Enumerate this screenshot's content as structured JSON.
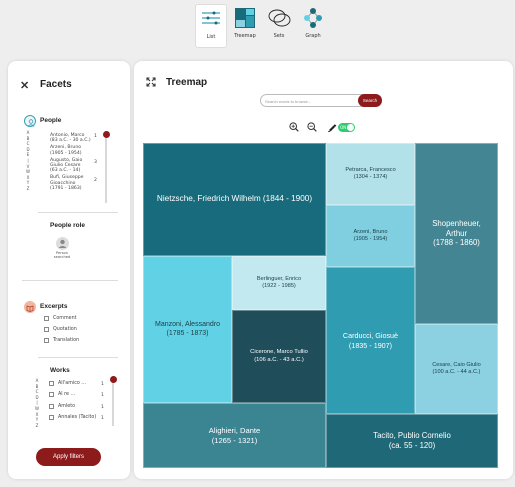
{
  "views": [
    {
      "label": "List",
      "icon": "list-icon",
      "active": true
    },
    {
      "label": "Treemap",
      "icon": "treemap-icon",
      "active": false
    },
    {
      "label": "Sets",
      "icon": "sets-icon",
      "active": false
    },
    {
      "label": "Graph",
      "icon": "graph-icon",
      "active": false
    }
  ],
  "facets": {
    "title": "Facets",
    "people": {
      "title": "People",
      "alphabet_top": [
        "A",
        "B",
        "C",
        "D",
        "E"
      ],
      "alphabet_bottom": [
        "V",
        "W",
        "X",
        "Y",
        "Z"
      ],
      "items": [
        {
          "name": "Antonio, Marco (83 a.C. - 30 a.C.)",
          "line1": "Antonio, Marco",
          "line2": "(83 a.C. - 30 a.C.)",
          "count": "1"
        },
        {
          "name": "Arzeni, Bruno (1905 - 1954)",
          "line1": "Arzeni, Bruno",
          "line2": "(1905 - 1954)",
          "count": ""
        },
        {
          "name": "Augusto, Gaio Giulio Cesare Ottaviano (63 a.C. - 14)",
          "line1": "Augusto, Gaio",
          "line2": "Giulio Cesare",
          "line3": "(63 a.C. - 14)",
          "count": "3"
        },
        {
          "name": "Bufi, Giuseppe Gioacchino (1791 - 1863)",
          "line1": "Bufi, Giuseppe",
          "line2": "Gioacchino",
          "line3": "(1791 - 1863)",
          "count": "2"
        }
      ]
    },
    "people_role": {
      "title": "People role",
      "role_label": "Person searched"
    },
    "excerpts": {
      "title": "Excerpts",
      "options": [
        "Comment",
        "Quotation",
        "Translation"
      ]
    },
    "works": {
      "title": "Works",
      "alphabet_top": [
        "A",
        "B",
        "C",
        "D"
      ],
      "alphabet_bottom": [
        "W",
        "X",
        "Y",
        "Z"
      ],
      "items": [
        {
          "name": "All'amico …",
          "count": "1"
        },
        {
          "name": "Al re …",
          "count": "1"
        },
        {
          "name": "Amleto",
          "count": "1"
        },
        {
          "name": "Annales (Tacito)",
          "count": "1"
        }
      ]
    },
    "apply_label": "Apply filters"
  },
  "main": {
    "title": "Treemap",
    "search": {
      "placeholder": "Search words to browse...",
      "button": "Search"
    },
    "toggle_label": "ON",
    "colors": {
      "accent": "#8e1b1b",
      "toggle": "#2ecc71"
    },
    "tiles": [
      {
        "label": "Nietzsche, Friedrich Wilhelm (1844 - 1900)",
        "line1": "Nietzsche, Friedrich  Wilhelm (1844 - 1900)",
        "line2": "",
        "color": "#186b7c"
      },
      {
        "label": "Manzoni, Alessandro (1785 - 1873)",
        "line1": "Manzoni, Alessandro",
        "line2": "(1785 - 1873)",
        "color": "#61d2e6"
      },
      {
        "label": "Berlinguer, Enrico (1922 - 1985)",
        "line1": "Berlinguer, Enrico",
        "line2": "(1922 - 1985)",
        "color": "#c3e9f0"
      },
      {
        "label": "Cicerone, Marco Tullio (106 a.C. - 43 a.C.)",
        "line1": "Cicerone, Marco Tullio",
        "line2": "(106 a.C. - 43 a.C.)",
        "color": "#1f4d5a"
      },
      {
        "label": "Alighieri, Dante (1265 - 1321)",
        "line1": "Alighieri, Dante",
        "line2": "(1265 - 1321)",
        "color": "#3b8592"
      },
      {
        "label": "Petrarca, Francesco (1304 - 1374)",
        "line1": "Petrarca, Francesco",
        "line2": "(1304 - 1374)",
        "color": "#b2e1ea"
      },
      {
        "label": "Arzeni, Bruno (1905 - 1954)",
        "line1": "Arzeni, Bruno",
        "line2": "(1905 - 1954)",
        "color": "#7fcfe0"
      },
      {
        "label": "Carducci, Giosuè (1835 - 1907)",
        "line1": "Carducci, Giosuè",
        "line2": "(1835 - 1907)",
        "color": "#2f9cb2"
      },
      {
        "label": "Shopenheuer, Arthur (1788 - 1860)",
        "line1": "Shopenheuer,",
        "line2": "Arthur",
        "line3": "(1788 - 1860)",
        "color": "#438592"
      },
      {
        "label": "Cesare, Caio Giulio (100 a.C. - 44 a.C.)",
        "line1": "Cesare, Caio Giulio",
        "line2": "(100 a.C. - 44 a.C.)",
        "color": "#8bd1e2"
      },
      {
        "label": "Tacito, Publio Cornelio (ca. 55 - 120)",
        "line1": "Tacito, Publio Cornelio",
        "line2": "(ca. 55 - 120)",
        "color": "#1f6877"
      }
    ]
  }
}
